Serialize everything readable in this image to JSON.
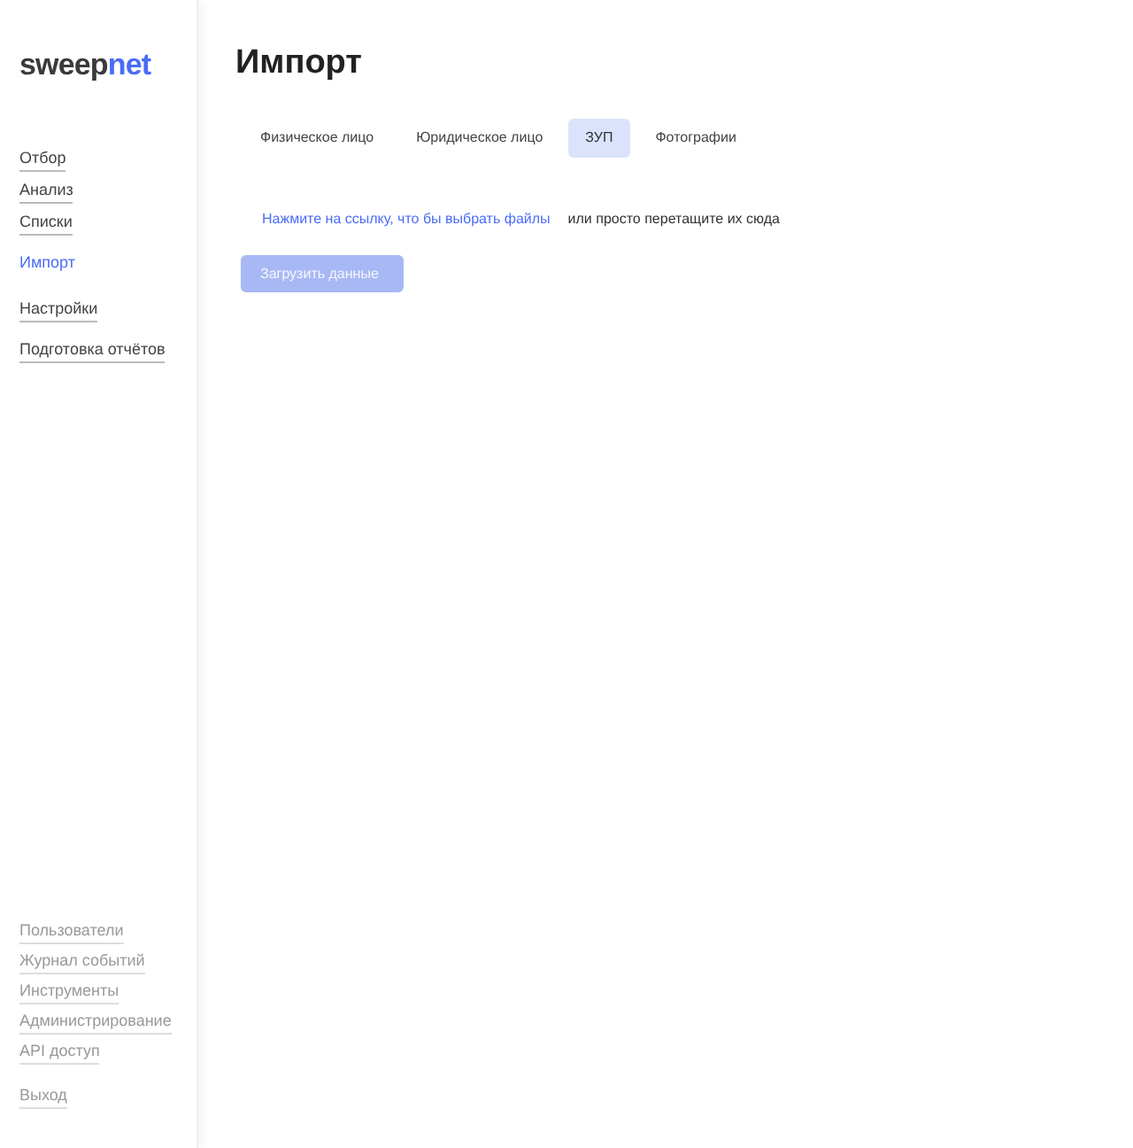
{
  "logo": {
    "main": "sweep",
    "accent": "net"
  },
  "nav": [
    {
      "label": "Отбор",
      "selected": false
    },
    {
      "label": "Анализ",
      "selected": false
    },
    {
      "label": "Списки",
      "selected": false
    },
    {
      "label": "Импорт",
      "selected": true
    },
    {
      "label": "Настройки",
      "selected": false
    },
    {
      "label": "Подготовка отчётов",
      "selected": false
    }
  ],
  "admin_nav": [
    "Пользователи",
    "Журнал событий",
    "Инструменты",
    "Администрирование",
    "API доступ"
  ],
  "logout": "Выход",
  "page_title": "Импорт",
  "tabs": [
    {
      "label": "Физическое лицо",
      "selected": false
    },
    {
      "label": "Юридическое лицо",
      "selected": false
    },
    {
      "label": "ЗУП",
      "selected": true
    },
    {
      "label": "Фотографии",
      "selected": false
    }
  ],
  "upload": {
    "link": "Нажмите на ссылку, что бы выбрать файлы",
    "hint": "или просто перетащите их сюда"
  },
  "submit": {
    "label": "Загрузить данные",
    "disabled": true
  }
}
